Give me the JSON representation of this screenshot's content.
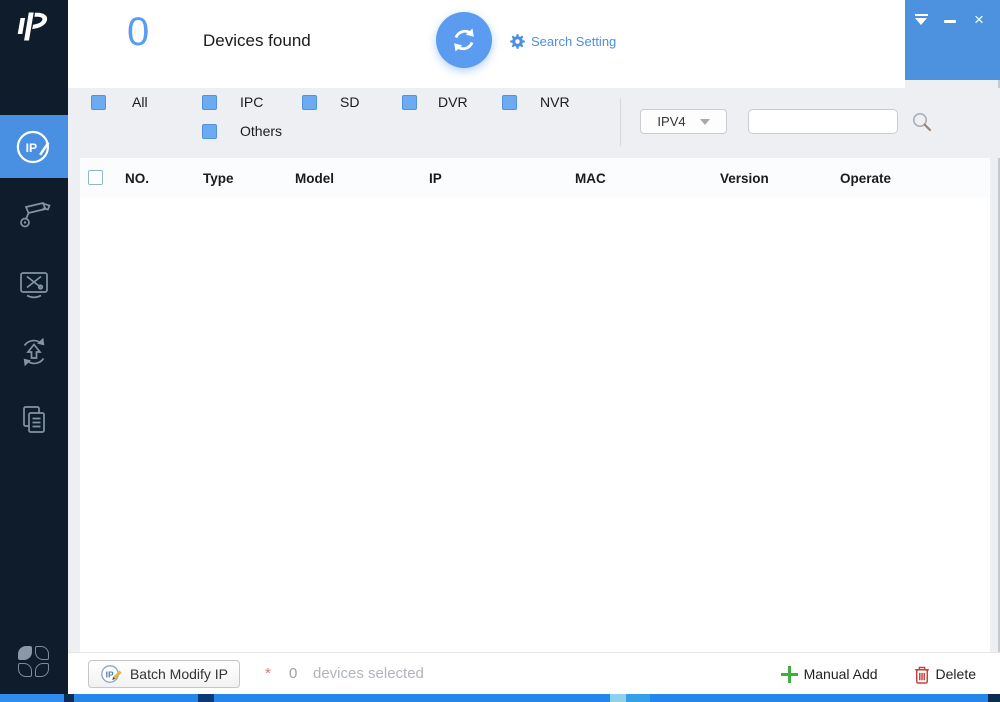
{
  "titlebar": {
    "minimize_glyph": "–",
    "close_glyph": "×"
  },
  "header": {
    "device_count": "0",
    "title": "Devices found",
    "search_setting_label": "Search Setting"
  },
  "sidebar": {
    "items": [
      {
        "icon": "ip-config-icon",
        "active": true
      },
      {
        "icon": "camera-config-icon",
        "active": false
      },
      {
        "icon": "system-tools-icon",
        "active": false
      },
      {
        "icon": "upgrade-icon",
        "active": false
      },
      {
        "icon": "documents-icon",
        "active": false
      },
      {
        "icon": "apps-clover-icon",
        "active": false
      }
    ]
  },
  "filters": {
    "checkboxes": [
      {
        "label": "All",
        "checked": true
      },
      {
        "label": "IPC",
        "checked": true
      },
      {
        "label": "SD",
        "checked": true
      },
      {
        "label": "DVR",
        "checked": true
      },
      {
        "label": "NVR",
        "checked": true
      },
      {
        "label": "Others",
        "checked": true
      }
    ],
    "protocol_select": {
      "value": "IPV4"
    },
    "search": {
      "value": "",
      "placeholder": ""
    }
  },
  "table": {
    "columns": [
      "NO.",
      "Type",
      "Model",
      "IP",
      "MAC",
      "Version",
      "Operate"
    ],
    "select_all_checked": false,
    "rows": []
  },
  "footer": {
    "batch_modify_label": "Batch Modify IP",
    "required_marker": "*",
    "selected_count": "0",
    "selected_label": "devices selected",
    "manual_add_label": "Manual Add",
    "delete_label": "Delete"
  },
  "colors": {
    "accent": "#4a90e2",
    "refresh_button": "#5b9cf0",
    "titlebar_blue": "#4c92de",
    "sidebar_bg": "#0e1c2b",
    "checkbox_fill": "#6cabf2",
    "success_green": "#3fae3f",
    "danger_red": "#c4403a"
  }
}
